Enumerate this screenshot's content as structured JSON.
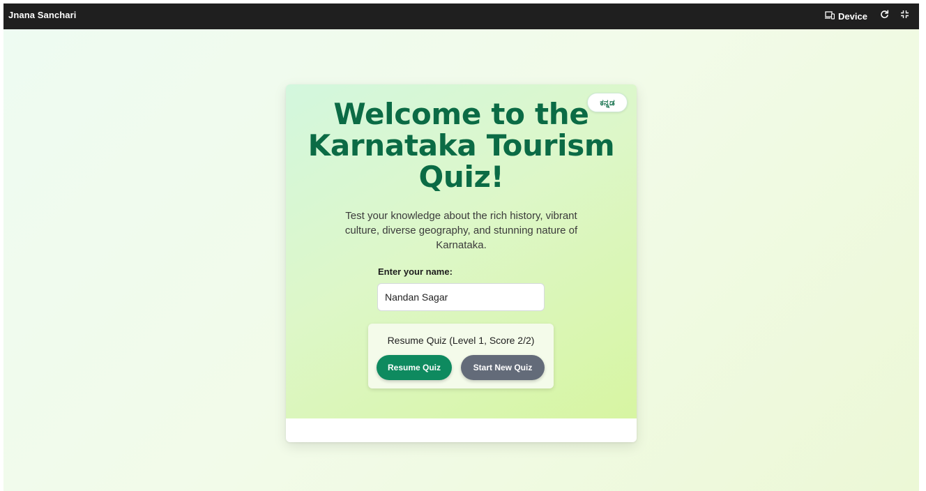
{
  "topbar": {
    "app_title": "Jnana Sanchari",
    "device_label": "Device",
    "icons": {
      "device": "device-icon",
      "refresh": "refresh-icon",
      "fullscreen": "fullscreen-icon"
    }
  },
  "card": {
    "language_toggle": "ಕನ್ನಡ",
    "title": "Welcome to the Karnataka Tourism Quiz!",
    "description": "Test your knowledge about the rich history, vibrant culture, diverse geography, and stunning nature of Karnataka.",
    "name_label": "Enter your name:",
    "name_value": "Nandan Sagar",
    "resume_info": "Resume Quiz (Level 1, Score 2/2)",
    "resume_button": "Resume Quiz",
    "new_quiz_button": "Start New Quiz"
  },
  "colors": {
    "topbar_bg": "#1f1f1f",
    "title_green": "#0b6b45",
    "resume_button_bg": "#0e8a5f",
    "new_quiz_button_bg": "#636b79"
  }
}
